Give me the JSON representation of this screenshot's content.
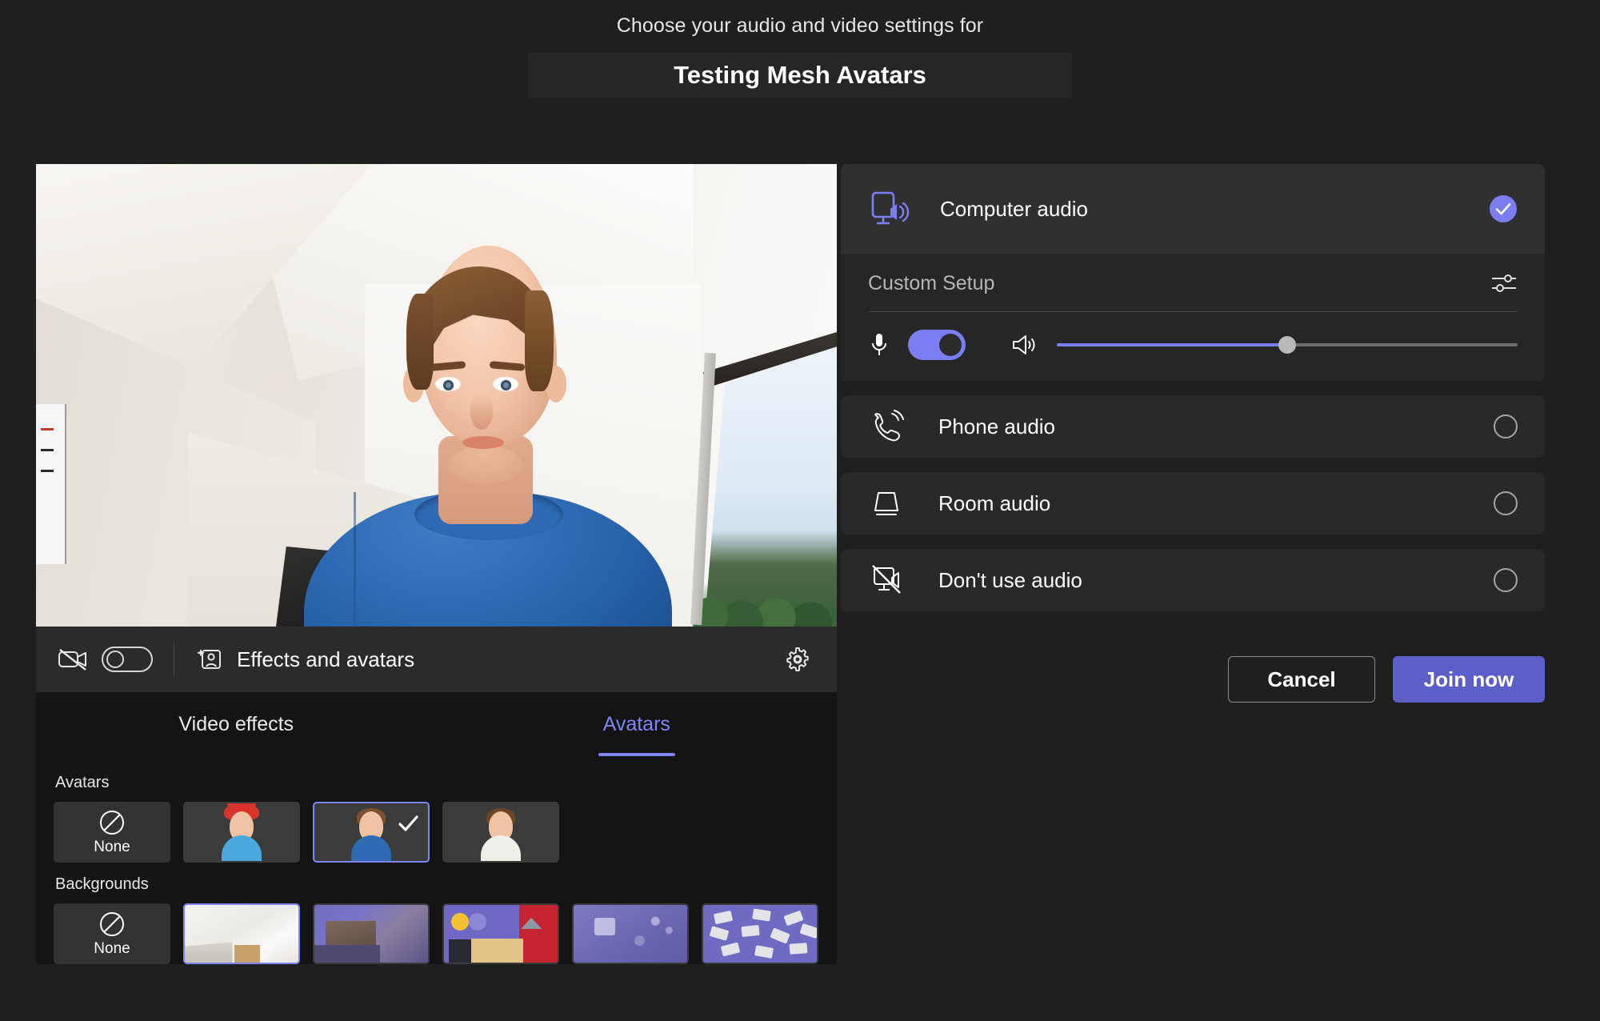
{
  "header": {
    "subtitle": "Choose your audio and video settings for",
    "meeting_title": "Testing Mesh Avatars"
  },
  "video": {
    "camera_toggle_label": "camera-toggle",
    "camera_state": "off",
    "effects_label": "Effects and avatars",
    "settings_label": "Device settings"
  },
  "tabs": [
    {
      "label": "Video effects",
      "active": false
    },
    {
      "label": "Avatars",
      "active": true
    }
  ],
  "gallery": {
    "avatars_section_label": "Avatars",
    "backgrounds_section_label": "Backgrounds",
    "none_label": "None",
    "avatars": [
      {
        "name": "none",
        "selected": false
      },
      {
        "name": "avatar-red-hat",
        "selected": false,
        "shirt": "#4aa8dd",
        "hair": "#8a5a34"
      },
      {
        "name": "avatar-blue-shirt",
        "selected": true,
        "shirt": "#2f6bb4",
        "hair": "#7a5130"
      },
      {
        "name": "avatar-white-shirt",
        "selected": false,
        "shirt": "#efeee9",
        "hair": "#6d4627"
      }
    ],
    "backgrounds": [
      {
        "name": "none",
        "selected": false
      },
      {
        "name": "bright-room",
        "selected": true
      },
      {
        "name": "purple-living-room",
        "selected": false
      },
      {
        "name": "colorful-room",
        "selected": false
      },
      {
        "name": "purple-abstract",
        "selected": false
      },
      {
        "name": "purple-scattered-cards",
        "selected": false
      }
    ]
  },
  "audio": {
    "computer_audio": {
      "label": "Computer audio",
      "selected": true,
      "custom_setup_label": "Custom Setup",
      "mic_enabled": true,
      "volume_percent": 50
    },
    "options": [
      {
        "label": "Phone audio",
        "selected": false,
        "icon": "phone-icon"
      },
      {
        "label": "Room audio",
        "selected": false,
        "icon": "room-speaker-icon"
      },
      {
        "label": "Don't use audio",
        "selected": false,
        "icon": "no-audio-icon"
      }
    ]
  },
  "actions": {
    "cancel_label": "Cancel",
    "join_label": "Join now"
  },
  "colors": {
    "accent": "#5b5fc7",
    "accent_light": "#7b7ef0",
    "panel": "#292929",
    "background": "#1f1f1f"
  }
}
